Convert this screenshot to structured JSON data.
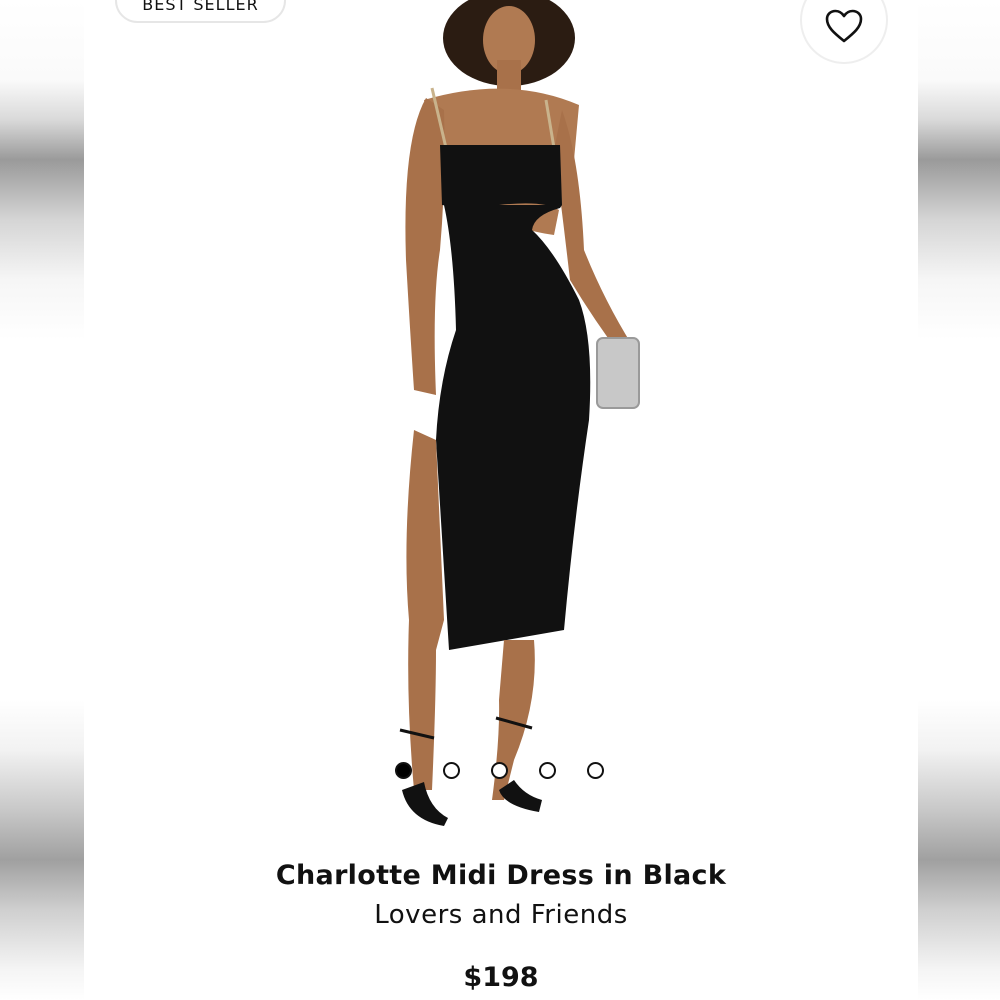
{
  "product": {
    "badge": "BEST SELLER",
    "title": "Charlotte Midi Dress in Black",
    "brand": "Lovers and Friends",
    "price": "$198",
    "favorite_icon": "heart-outline-icon",
    "carousel": {
      "total": 5,
      "active_index": 0
    }
  },
  "colors": {
    "dress": "#111111",
    "text": "#111111",
    "badge_border": "#e6e6e6"
  }
}
